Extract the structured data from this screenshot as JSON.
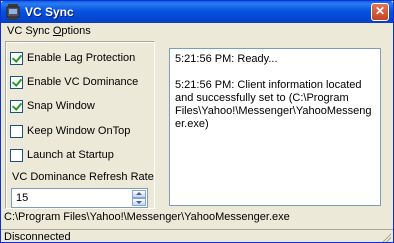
{
  "window": {
    "title": "VC Sync",
    "close_label": "✕"
  },
  "menu": {
    "items": [
      {
        "label": "VC Sync Options",
        "mnemonic": "O"
      }
    ]
  },
  "options": [
    {
      "label": "Enable Lag Protection",
      "checked": true
    },
    {
      "label": "Enable VC Dominance",
      "checked": true
    },
    {
      "label": "Snap Window",
      "checked": true
    },
    {
      "label": "Keep Window OnTop",
      "checked": false
    },
    {
      "label": "Launch at Startup",
      "checked": false
    }
  ],
  "refresh_rate": {
    "label": "VC Dominance Refresh Rate",
    "value": "15"
  },
  "log": {
    "lines": [
      "5:21:56 PM: Ready...",
      "5:21:56 PM: Client information located and successfully set to (C:\\Program Files\\Yahoo!\\Messenger\\YahooMessenger.exe)"
    ]
  },
  "client_path": "C:\\Program Files\\Yahoo!\\Messenger\\YahooMessenger.exe",
  "status": "Disconnected",
  "colors": {
    "titlebar": "#0553df",
    "window_bg": "#ece9d8",
    "checkmark": "#21a121"
  }
}
